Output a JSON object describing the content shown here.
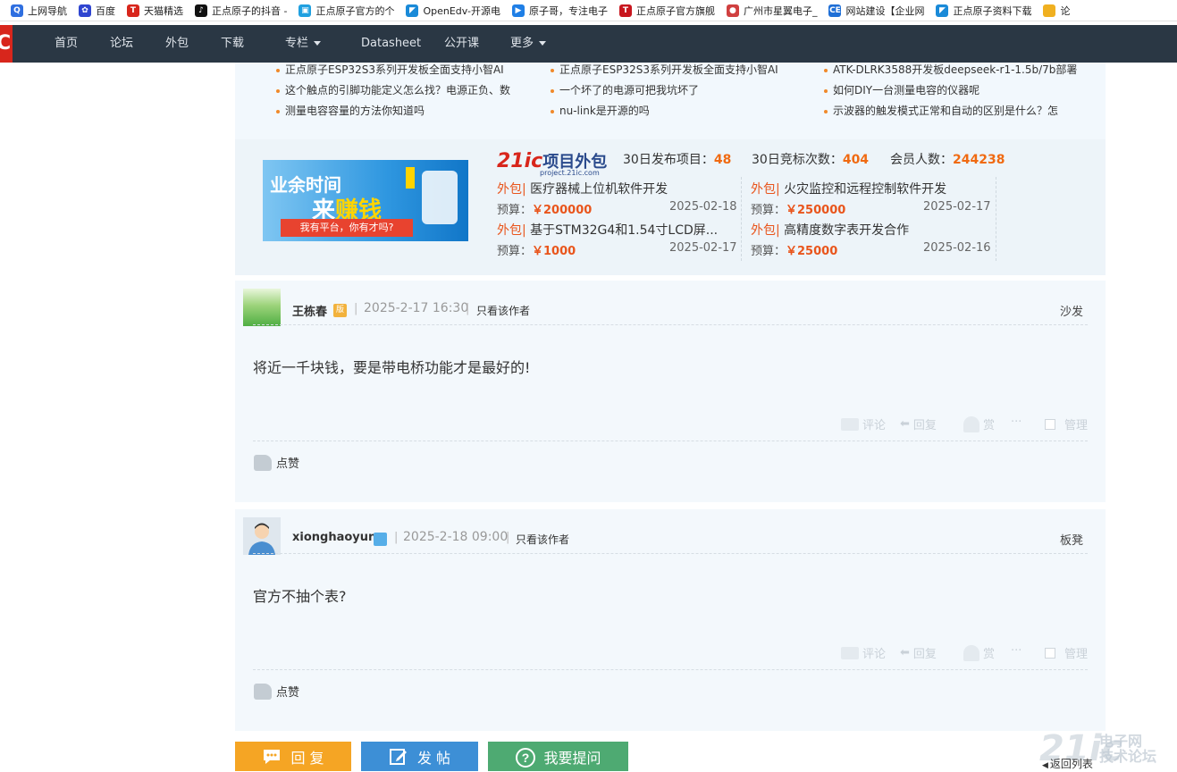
{
  "bookmarks": [
    {
      "label": "上网导航",
      "icon": "search-q-icon",
      "color": "#2f6fe0"
    },
    {
      "label": "百度",
      "icon": "baidu-paw-icon",
      "color": "#2f45d0"
    },
    {
      "label": "天猫精选",
      "icon": "tmall-t-icon",
      "color": "#d8261c"
    },
    {
      "label": "正点原子的抖音 -",
      "icon": "douyin-icon",
      "color": "#111111"
    },
    {
      "label": "正点原子官方的个",
      "icon": "bilibili-icon",
      "color": "#20a0e0"
    },
    {
      "label": "OpenEdv-开源电",
      "icon": "openedv-icon",
      "color": "#1a8ad8"
    },
    {
      "label": "原子哥，专注电子",
      "icon": "play-icon",
      "color": "#1f7fe6"
    },
    {
      "label": "正点原子官方旗舰",
      "icon": "tmall-t-icon",
      "color": "#c8161e"
    },
    {
      "label": "广州市星翼电子_",
      "icon": "chrome-icon",
      "color": "#d04040"
    },
    {
      "label": "网站建设【企业网",
      "icon": "ce-icon",
      "color": "#1f6fd6"
    },
    {
      "label": "正点原子资料下载",
      "icon": "openedv-icon",
      "color": "#1a8ad8"
    },
    {
      "label": "论",
      "icon": "folder-icon",
      "color": "#f0b020"
    }
  ],
  "nav": {
    "items": [
      "首页",
      "论坛",
      "外包",
      "下载",
      "专栏",
      "Datasheet",
      "公开课",
      "更多"
    ]
  },
  "hot_topics": [
    [
      "正点原子ESP32S3系列开发板全面支持小智AI",
      "正点原子ESP32S3系列开发板全面支持小智AI",
      "ATK-DLRK3588开发板deepseek-r1-1.5b/7b部署"
    ],
    [
      "这个触点的引脚功能定义怎么找？电源正负、数",
      "一个坏了的电源可把我坑坏了",
      "如何DIY一台测量电容的仪器呢"
    ],
    [
      "测量电容容量的方法你知道吗",
      "nu-link是开源的吗",
      "示波器的触发模式正常和自动的区别是什么？怎"
    ]
  ],
  "waibao": {
    "banner": {
      "line1": "业余时间",
      "line2a": "来",
      "line2b": "赚钱",
      "ribbon": "我有平台，你有才吗?"
    },
    "logo": {
      "brand": "21ic",
      "name": "项目外包",
      "url": "project.21ic.com"
    },
    "stats": [
      {
        "label": "30日发布项目：",
        "value": "48"
      },
      {
        "label": "30日竞标次数：",
        "value": "404"
      },
      {
        "label": "会员人数：",
        "value": "244238"
      }
    ],
    "tag": "外包|",
    "budget_label": "预算：",
    "projects": [
      {
        "title": "医疗器械上位机软件开发",
        "budget": "￥200000",
        "date": "2025-02-18"
      },
      {
        "title": "火灾监控和远程控制软件开发",
        "budget": "￥250000",
        "date": "2025-02-17"
      },
      {
        "title": "基于STM32G4和1.54寸LCD屏...",
        "budget": "￥1000",
        "date": "2025-02-17"
      },
      {
        "title": "高精度数字表开发合作",
        "budget": "￥25000",
        "date": "2025-02-16"
      }
    ]
  },
  "posts": [
    {
      "user": "王栋春",
      "badge": "版",
      "time": "2025-2-17 16:30",
      "only_author": "只看该作者",
      "floor": "沙发",
      "body": "将近一千块钱，要是带电桥功能才是最好的!",
      "actions": {
        "comment": "评论",
        "reply": "回复",
        "reward": "赏",
        "more": "···",
        "manage": "管理"
      },
      "like": "点赞"
    },
    {
      "user": "xionghaoyun",
      "badge": "",
      "time": "2025-2-18 09:00",
      "only_author": "只看该作者",
      "floor": "板凳",
      "body": "官方不抽个表?",
      "actions": {
        "comment": "评论",
        "reply": "回复",
        "reward": "赏",
        "more": "···",
        "manage": "管理"
      },
      "like": "点赞"
    }
  ],
  "bottom": {
    "reply": "回 复",
    "post": "发 帖",
    "ask": "我要提问",
    "back": "返回列表",
    "watermark": "21ic",
    "watermark_cn1": "电子网",
    "watermark_cn2": "技术论坛",
    "colors": {
      "reply": "#f5a524",
      "post": "#3d8fd6",
      "ask": "#4eaa72"
    }
  }
}
